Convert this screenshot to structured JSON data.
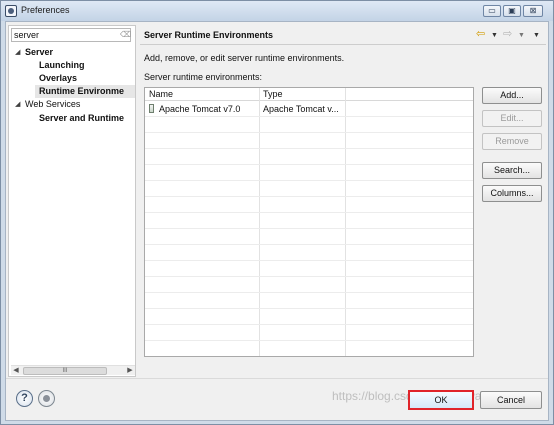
{
  "window": {
    "title": "Preferences",
    "controls": {
      "minimize": "▭",
      "maximize": "▣",
      "close": "⊠"
    }
  },
  "left": {
    "filter_value": "server",
    "tree": [
      {
        "label": "Server",
        "bold": true,
        "expanded": true
      },
      {
        "label": "Launching",
        "bold": true
      },
      {
        "label": "Overlays",
        "bold": true
      },
      {
        "label": "Runtime Environme",
        "bold": true,
        "selected": true
      },
      {
        "label": "Web Services",
        "bold": false,
        "expanded": true
      },
      {
        "label": "Server and Runtime",
        "bold": true
      }
    ],
    "hscroll_thumb_label": "III"
  },
  "page": {
    "title": "Server Runtime Environments",
    "description": "Add, remove, or edit server runtime environments.",
    "list_label": "Server runtime environments:",
    "columns": [
      "Name",
      "Type"
    ],
    "rows": [
      {
        "name": "Apache Tomcat v7.0",
        "type": "Apache Tomcat v..."
      }
    ],
    "buttons": {
      "add": "Add...",
      "edit": "Edit...",
      "remove": "Remove",
      "search": "Search...",
      "columns": "Columns..."
    }
  },
  "footer": {
    "ok": "OK",
    "cancel": "Cancel",
    "help_glyph": "?",
    "watermark": "https://blog.csdn.net/fangwang"
  },
  "colors": {
    "ok_highlight": "#e0242a",
    "selection": "#e6e6e6"
  }
}
